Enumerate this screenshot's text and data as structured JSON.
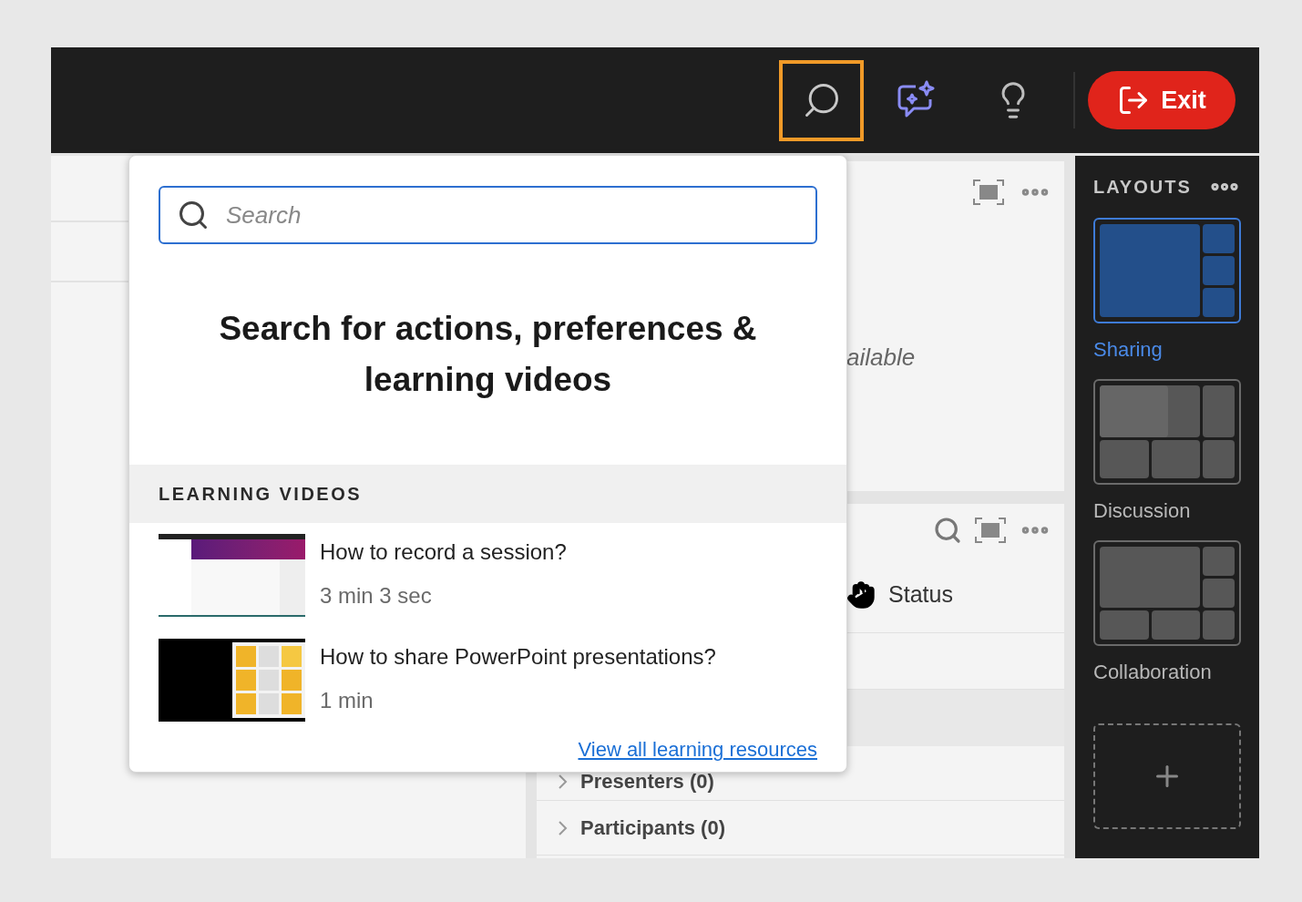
{
  "toolbar": {
    "buttons": [
      {
        "kind": "search",
        "highlighted": true
      },
      {
        "kind": "assistant",
        "highlighted": false
      },
      {
        "kind": "tips",
        "highlighted": false
      }
    ],
    "exit_button": {
      "label": "Exit"
    }
  },
  "search_popup": {
    "search": {
      "placeholder": "Search"
    },
    "heading": "Search for actions, preferences & learning videos",
    "section_title": "LEARNING VIDEOS",
    "videos": [
      {
        "title": "How to record a session?",
        "duration": "3 min 3 sec",
        "kind": "slides"
      },
      {
        "title": "How to share PowerPoint presentations?",
        "duration": "1 min",
        "kind": "title"
      }
    ],
    "link": "View all learning resources"
  },
  "top_pod": {
    "message": "ailable"
  },
  "attendees_pod": {
    "column": "Status",
    "groups": [
      {
        "label": "Presenters (0)",
        "expanded": false
      },
      {
        "label": "Participants (0)",
        "expanded": false
      }
    ]
  },
  "layouts": {
    "title": "LAYOUTS",
    "items": [
      {
        "label": "Sharing",
        "selected": true,
        "kind": "sharing"
      },
      {
        "label": "Discussion",
        "selected": false,
        "kind": "discussion"
      },
      {
        "label": "Collaboration",
        "selected": false,
        "kind": "collaboration"
      }
    ]
  }
}
